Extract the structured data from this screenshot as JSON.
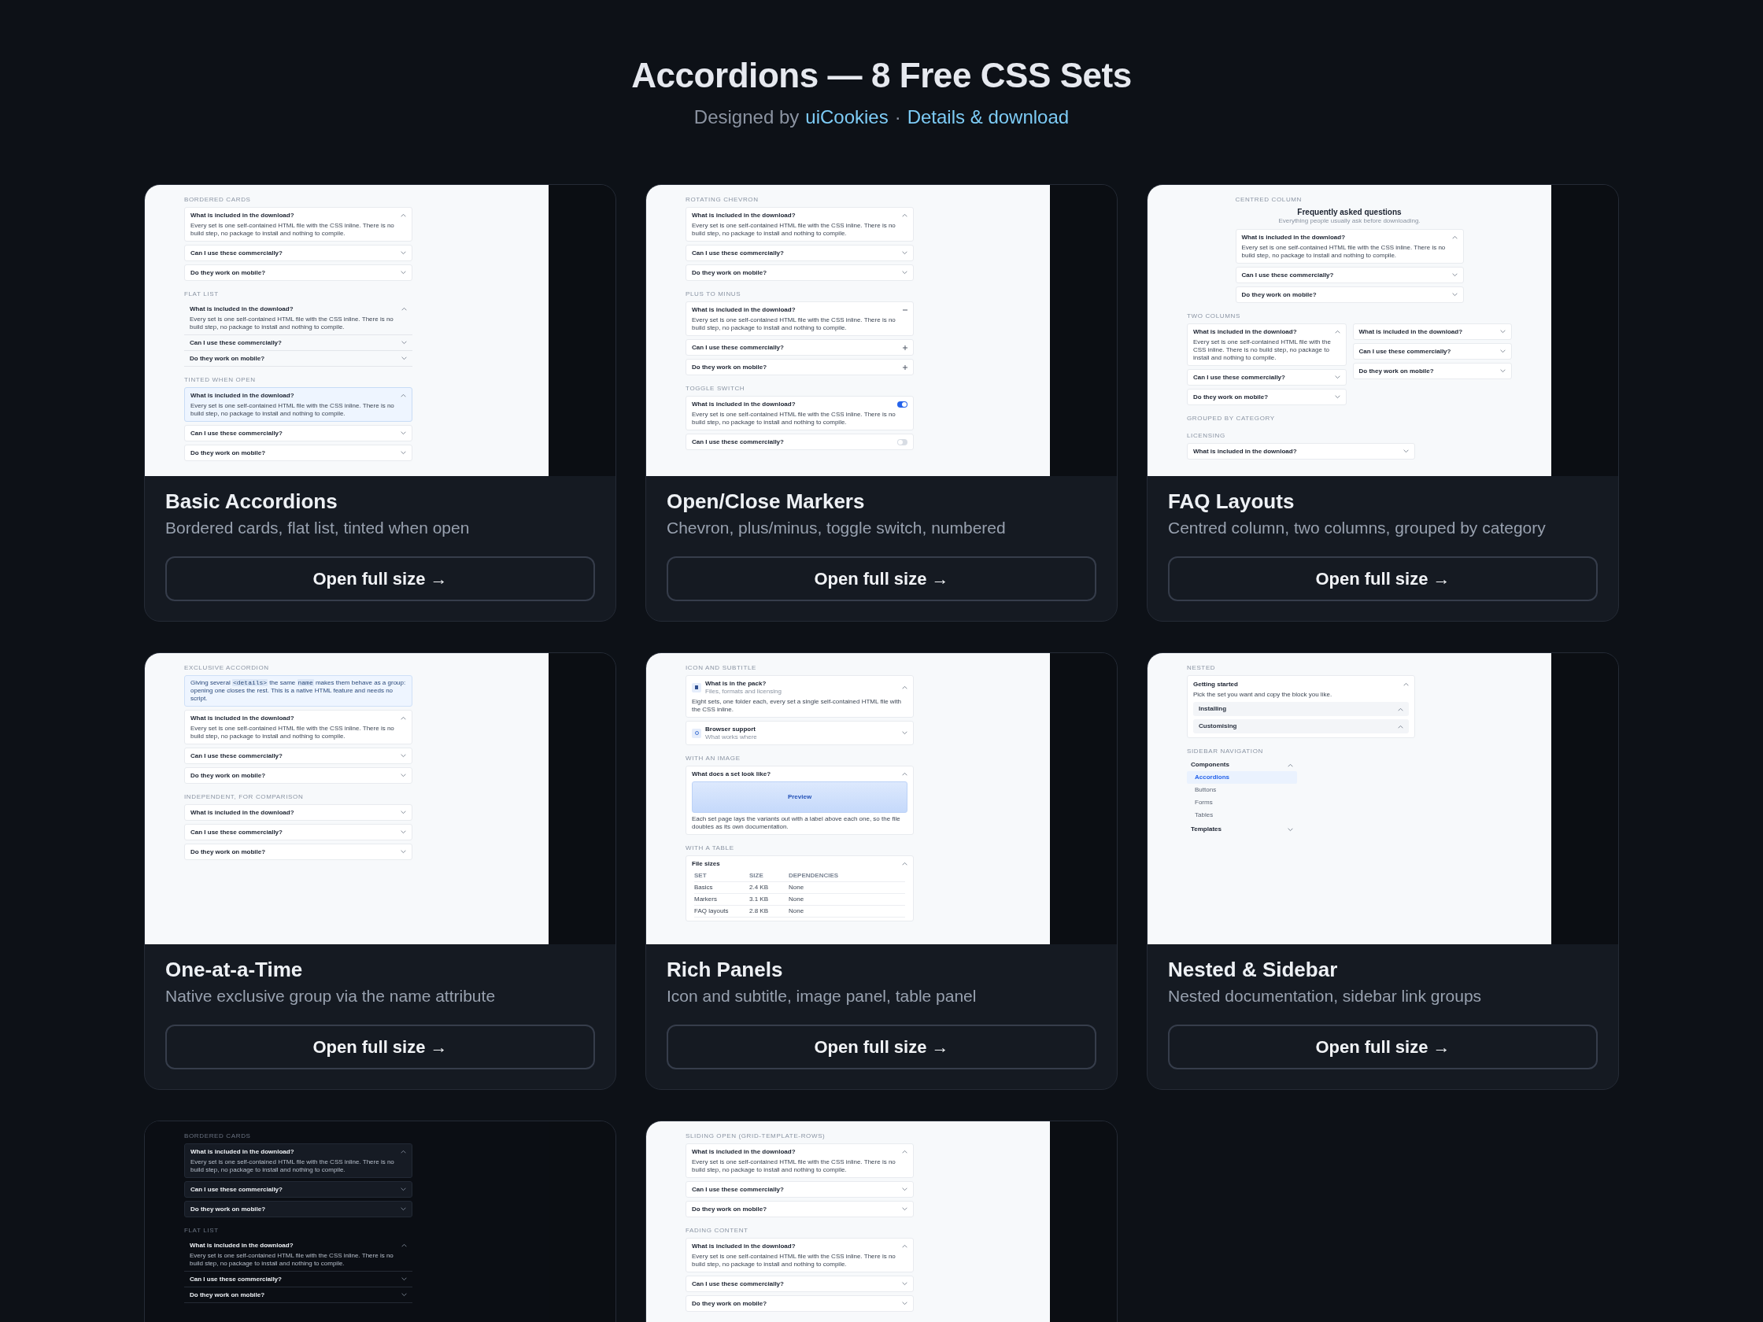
{
  "header": {
    "title": "Accordions — 8 Free CSS Sets",
    "byline": {
      "prefix": "Designed by",
      "author": "uiCookies",
      "separator": "·",
      "link": "Details & download"
    }
  },
  "cards": [
    {
      "thumbnail": {
        "kind": "light_page",
        "blocks": [
          {
            "kind": "label",
            "text": "BORDERED CARDS"
          },
          {
            "kind": "cards_accordion",
            "items": [
              {
                "question": "What is included in the download?",
                "answer": "Every set is one self-contained HTML file with the CSS inline. There is no build step, no package to install and nothing to compile.",
                "expanded": true
              },
              {
                "question": "Can I use these commercially?",
                "expanded": false
              },
              {
                "question": "Do they work on mobile?",
                "expanded": false
              }
            ]
          },
          {
            "kind": "label",
            "text": "FLAT LIST"
          },
          {
            "kind": "flat_accordion",
            "items": [
              {
                "question": "What is included in the download?",
                "answer": "Every set is one self-contained HTML file with the CSS inline. There is no build step, no package to install and nothing to compile.",
                "expanded": true
              },
              {
                "question": "Can I use these commercially?",
                "expanded": false
              },
              {
                "question": "Do they work on mobile?",
                "expanded": false
              }
            ]
          },
          {
            "kind": "label",
            "text": "TINTED WHEN OPEN"
          },
          {
            "kind": "tinted_accordion",
            "items": [
              {
                "question": "What is included in the download?",
                "answer": "Every set is one self-contained HTML file with the CSS inline. There is no build step, no package to install and nothing to compile.",
                "expanded": true
              },
              {
                "question": "Can I use these commercially?",
                "expanded": false
              },
              {
                "question": "Do they work on mobile?",
                "expanded": false
              }
            ]
          }
        ]
      },
      "title": "Basic Accordions",
      "subtitle": "Bordered cards, flat list, tinted when open",
      "button": "Open full size →"
    },
    {
      "thumbnail": {
        "kind": "light_page",
        "blocks": [
          {
            "kind": "label",
            "text": "ROTATING CHEVRON"
          },
          {
            "kind": "cards_accordion",
            "items": [
              {
                "question": "What is included in the download?",
                "answer": "Every set is one self-contained HTML file with the CSS inline. There is no build step, no package to install and nothing to compile.",
                "expanded": true
              },
              {
                "question": "Can I use these commercially?",
                "expanded": false
              },
              {
                "question": "Do they work on mobile?",
                "expanded": false
              }
            ]
          },
          {
            "kind": "label",
            "text": "PLUS TO MINUS"
          },
          {
            "kind": "plus_accordion",
            "items": [
              {
                "question": "What is included in the download?",
                "answer": "Every set is one self-contained HTML file with the CSS inline. There is no build step, no package to install and nothing to compile.",
                "expanded": true
              },
              {
                "question": "Can I use these commercially?",
                "expanded": false
              },
              {
                "question": "Do they work on mobile?",
                "expanded": false
              }
            ]
          },
          {
            "kind": "label",
            "text": "TOGGLE SWITCH"
          },
          {
            "kind": "toggle_accordion",
            "items": [
              {
                "question": "What is included in the download?",
                "answer": "Every set is one self-contained HTML file with the CSS inline. There is no build step, no package to install and nothing to compile.",
                "expanded": true
              },
              {
                "question": "Can I use these commercially?",
                "expanded": false
              }
            ]
          }
        ]
      },
      "title": "Open/Close Markers",
      "subtitle": "Chevron, plus/minus, toggle switch, numbered",
      "button": "Open full size →"
    },
    {
      "thumbnail": {
        "kind": "light_page",
        "blocks": [
          {
            "kind": "centered",
            "blocks": [
              {
                "kind": "label",
                "text": "CENTRED COLUMN"
              },
              {
                "kind": "heading",
                "title": "Frequently asked questions",
                "subtitle": "Everything people usually ask before downloading."
              },
              {
                "kind": "cards_accordion",
                "items": [
                  {
                    "question": "What is included in the download?",
                    "answer": "Every set is one self-contained HTML file with the CSS inline. There is no build step, no package to install and nothing to compile.",
                    "expanded": true
                  },
                  {
                    "question": "Can I use these commercially?",
                    "expanded": false
                  },
                  {
                    "question": "Do they work on mobile?",
                    "expanded": false
                  }
                ]
              }
            ]
          },
          {
            "kind": "label",
            "text": "TWO COLUMNS"
          },
          {
            "kind": "columns",
            "columns": [
              {
                "items": [
                  {
                    "question": "What is included in the download?",
                    "answer": "Every set is one self-contained HTML file with the CSS inline. There is no build step, no package to install and nothing to compile.",
                    "expanded": true
                  },
                  {
                    "question": "Can I use these commercially?",
                    "expanded": false
                  },
                  {
                    "question": "Do they work on mobile?",
                    "expanded": false
                  }
                ]
              },
              {
                "items": [
                  {
                    "question": "What is included in the download?",
                    "expanded": false
                  },
                  {
                    "question": "Can I use these commercially?",
                    "expanded": false
                  },
                  {
                    "question": "Do they work on mobile?",
                    "expanded": false
                  }
                ]
              }
            ]
          },
          {
            "kind": "label",
            "text": "GROUPED BY CATEGORY"
          },
          {
            "kind": "label",
            "text": "LICENSING"
          },
          {
            "kind": "cards_accordion",
            "items": [
              {
                "question": "What is included in the download?",
                "expanded": false
              }
            ]
          }
        ]
      },
      "title": "FAQ Layouts",
      "subtitle": "Centred column, two columns, grouped by category",
      "button": "Open full size →"
    },
    {
      "thumbnail": {
        "kind": "light_page",
        "blocks": [
          {
            "kind": "label",
            "text": "EXCLUSIVE ACCORDION"
          },
          {
            "kind": "info",
            "parts": [
              {
                "kind": "text",
                "text": "Giving several "
              },
              {
                "kind": "code",
                "text": "<details>"
              },
              {
                "kind": "text",
                "text": " the same "
              },
              {
                "kind": "code",
                "text": "name"
              },
              {
                "kind": "text",
                "text": " makes them behave as a group: opening one closes the rest. This is a native HTML feature and needs no script."
              }
            ]
          },
          {
            "kind": "cards_accordion",
            "items": [
              {
                "question": "What is included in the download?",
                "answer": "Every set is one self-contained HTML file with the CSS inline. There is no build step, no package to install and nothing to compile.",
                "expanded": true
              },
              {
                "question": "Can I use these commercially?",
                "expanded": false
              },
              {
                "question": "Do they work on mobile?",
                "expanded": false
              }
            ]
          },
          {
            "kind": "label",
            "text": "INDEPENDENT, FOR COMPARISON"
          },
          {
            "kind": "cards_accordion",
            "items": [
              {
                "question": "What is included in the download?",
                "expanded": false
              },
              {
                "question": "Can I use these commercially?",
                "expanded": false
              },
              {
                "question": "Do they work on mobile?",
                "expanded": false
              }
            ]
          }
        ]
      },
      "title": "One-at-a-Time",
      "subtitle": "Native exclusive group via the name attribute",
      "button": "Open full size →"
    },
    {
      "thumbnail": {
        "kind": "light_page",
        "blocks": [
          {
            "kind": "label",
            "text": "ICON AND SUBTITLE"
          },
          {
            "kind": "cards_accordion",
            "items": [
              {
                "kind": "icon",
                "question": "What is in the pack?",
                "subtitle": "Files, formats and licensing",
                "answer": "Eight sets, one folder each, every set a single self-contained HTML file with the CSS inline.",
                "expanded": true
              },
              {
                "kind": "icon",
                "question": "Browser support",
                "subtitle": "What works where",
                "expanded": false
              }
            ]
          },
          {
            "kind": "label",
            "text": "WITH AN IMAGE"
          },
          {
            "kind": "cards_accordion",
            "items": [
              {
                "kind": "image",
                "question": "What does a set look like?",
                "image_label": "Preview",
                "answer": "Each set page lays the variants out with a label above each one, so the file doubles as its own documentation.",
                "expanded": true
              }
            ]
          },
          {
            "kind": "label",
            "text": "WITH A TABLE"
          },
          {
            "kind": "cards_accordion",
            "items": [
              {
                "kind": "table",
                "question": "File sizes",
                "expanded": true,
                "columns": [
                  "SET",
                  "SIZE",
                  "DEPENDENCIES"
                ],
                "rows": [
                  [
                    "Basics",
                    "2.4 KB",
                    "None"
                  ],
                  [
                    "Markers",
                    "3.1 KB",
                    "None"
                  ],
                  [
                    "FAQ layouts",
                    "2.8 KB",
                    "None"
                  ]
                ]
              }
            ]
          }
        ]
      },
      "title": "Rich Panels",
      "subtitle": "Icon and subtitle, image panel, table panel",
      "button": "Open full size →"
    },
    {
      "thumbnail": {
        "kind": "light_page",
        "blocks": [
          {
            "kind": "label",
            "text": "NESTED"
          },
          {
            "kind": "nested",
            "title": "Getting started",
            "text": "Pick the set you want and copy the block you like.",
            "expanded": true,
            "children": [
              {
                "title": "Installing"
              },
              {
                "title": "Customising"
              }
            ]
          },
          {
            "kind": "label",
            "text": "SIDEBAR NAVIGATION"
          },
          {
            "kind": "sidebar",
            "groups": [
              {
                "title": "Components",
                "expanded": true,
                "children": [
                  {
                    "label": "Accordions",
                    "selected": true
                  },
                  {
                    "label": "Buttons",
                    "selected": false
                  },
                  {
                    "label": "Forms",
                    "selected": false
                  },
                  {
                    "label": "Tables",
                    "selected": false
                  }
                ]
              },
              {
                "title": "Templates",
                "expanded": false
              }
            ]
          }
        ]
      },
      "title": "Nested & Sidebar",
      "subtitle": "Nested documentation, sidebar link groups",
      "button": "Open full size →"
    },
    {
      "thumbnail": {
        "kind": "dark_page",
        "blocks": [
          {
            "kind": "label",
            "text": "BORDERED CARDS"
          },
          {
            "kind": "cards_accordion",
            "items": [
              {
                "question": "What is included in the download?",
                "answer": "Every set is one self-contained HTML file with the CSS inline. There is no build step, no package to install and nothing to compile.",
                "expanded": true
              },
              {
                "question": "Can I use these commercially?",
                "expanded": false
              },
              {
                "question": "Do they work on mobile?",
                "expanded": false
              }
            ]
          },
          {
            "kind": "label",
            "text": "FLAT LIST"
          },
          {
            "kind": "flat_accordion",
            "items": [
              {
                "question": "What is included in the download?",
                "answer": "Every set is one self-contained HTML file with the CSS inline. There is no build step, no package to install and nothing to compile.",
                "expanded": true
              },
              {
                "question": "Can I use these commercially?",
                "expanded": false
              },
              {
                "question": "Do they work on mobile?",
                "expanded": false
              }
            ]
          }
        ]
      }
    },
    {
      "thumbnail": {
        "kind": "light_page",
        "blocks": [
          {
            "kind": "label",
            "text": "SLIDING OPEN (GRID-TEMPLATE-ROWS)"
          },
          {
            "kind": "cards_accordion",
            "items": [
              {
                "question": "What is included in the download?",
                "answer": "Every set is one self-contained HTML file with the CSS inline. There is no build step, no package to install and nothing to compile.",
                "expanded": true
              },
              {
                "question": "Can I use these commercially?",
                "expanded": false
              },
              {
                "question": "Do they work on mobile?",
                "expanded": false
              }
            ]
          },
          {
            "kind": "label",
            "text": "FADING CONTENT"
          },
          {
            "kind": "cards_accordion",
            "items": [
              {
                "question": "What is included in the download?",
                "answer": "Every set is one self-contained HTML file with the CSS inline. There is no build step, no package to install and nothing to compile.",
                "expanded": true
              },
              {
                "question": "Can I use these commercially?",
                "expanded": false
              },
              {
                "question": "Do they work on mobile?",
                "expanded": false
              }
            ]
          }
        ]
      }
    }
  ]
}
